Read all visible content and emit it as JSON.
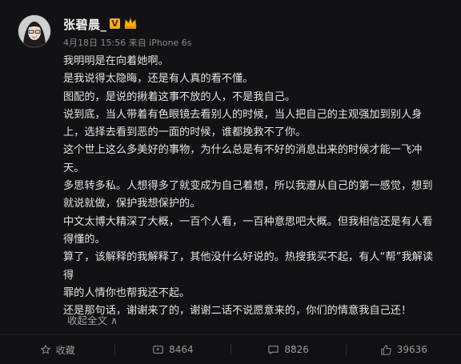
{
  "post": {
    "author": "张碧晨_",
    "meta": "4月18日 15:56 来自 iPhone 6s",
    "lines": [
      "我明明是在向着她啊。",
      "是我说得太隐晦，还是有人真的看不懂。",
      "图配的，是说的揪着这事不放的人，不是我自己。",
      "说到底，当人带着有色眼镜去看别人的时候，当人把自己的主观强加到别人身",
      "上，选择去看到恶的一面的时候，谁都挽救不了你。",
      "这个世上这么多美好的事物，为什么总是有不好的消息出来的时候才能一飞冲",
      "天。",
      "多思转多私。人想得多了就变成为自己着想，所以我遵从自己的第一感觉，想到",
      "就说就做，保护我想保护的。",
      "中文太博大精深了大概，一百个人看，一百种意思吧大概。但我相信还是有人看",
      "得懂的。",
      "算了，该解释的我解释了，其他没什么好说的。热搜我买不起，有人“帮”我解读得",
      "罪的人情你也帮我还不起。",
      "还是那句话，谢谢来了的，谢谢二话不说愿意来的，你们的情意我自己还！"
    ],
    "collapse_label": "收起全文 ∧"
  },
  "toolbar": {
    "favorite_label": "收藏",
    "repost_count": "8464",
    "comment_count": "8826",
    "like_count": "39636"
  },
  "colors": {
    "background": "#121214",
    "text": "#e2e2e2",
    "meta": "#8a8a8a",
    "badge": "#e8b32b"
  }
}
